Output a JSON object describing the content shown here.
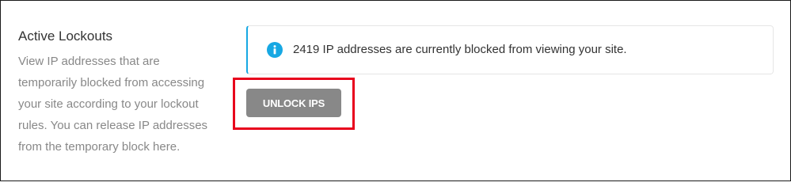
{
  "section": {
    "title": "Active Lockouts",
    "description": "View IP addresses that are temporarily blocked from accessing your site according to your lockout rules. You can release IP addresses from the temporary block here."
  },
  "notice": {
    "icon": "info-icon",
    "text": "2419 IP addresses are currently blocked from viewing your site.",
    "accent_color": "#17a8e3"
  },
  "actions": {
    "unlock_label": "UNLOCK IPS",
    "button_color": "#888888",
    "highlight_color": "#e8001c"
  }
}
